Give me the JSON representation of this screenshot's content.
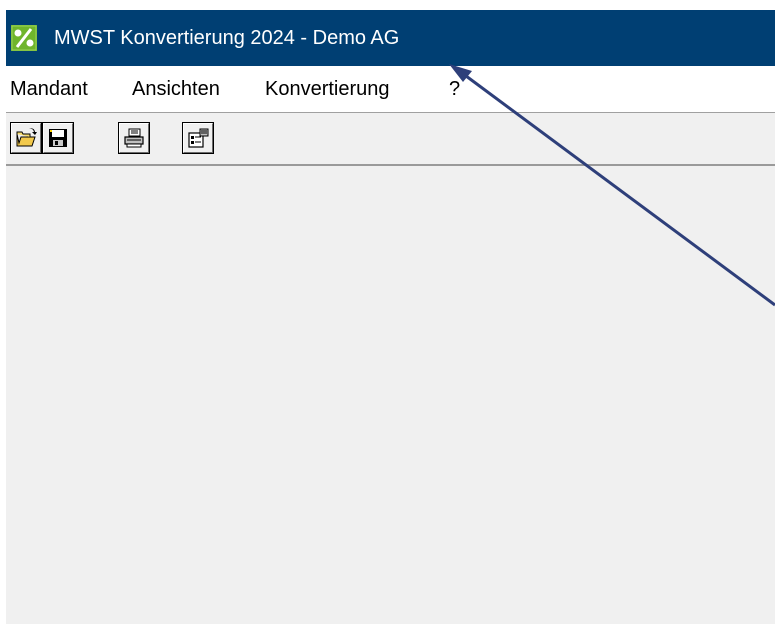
{
  "window": {
    "title": "MWST Konvertierung 2024 - Demo AG",
    "app_icon": "percent-app-icon",
    "title_bar_color": "#003f73"
  },
  "menu": {
    "items": [
      {
        "label": "Mandant"
      },
      {
        "label": "Ansichten"
      },
      {
        "label": "Konvertierung"
      },
      {
        "label": "?"
      }
    ]
  },
  "toolbar": {
    "buttons": [
      {
        "icon": "open-folder-icon"
      },
      {
        "icon": "save-disk-icon"
      },
      {
        "icon": "printer-icon"
      },
      {
        "icon": "properties-icon"
      }
    ]
  },
  "annotation": {
    "icon": "arrow-annotation",
    "color": "#2e3f7a"
  }
}
